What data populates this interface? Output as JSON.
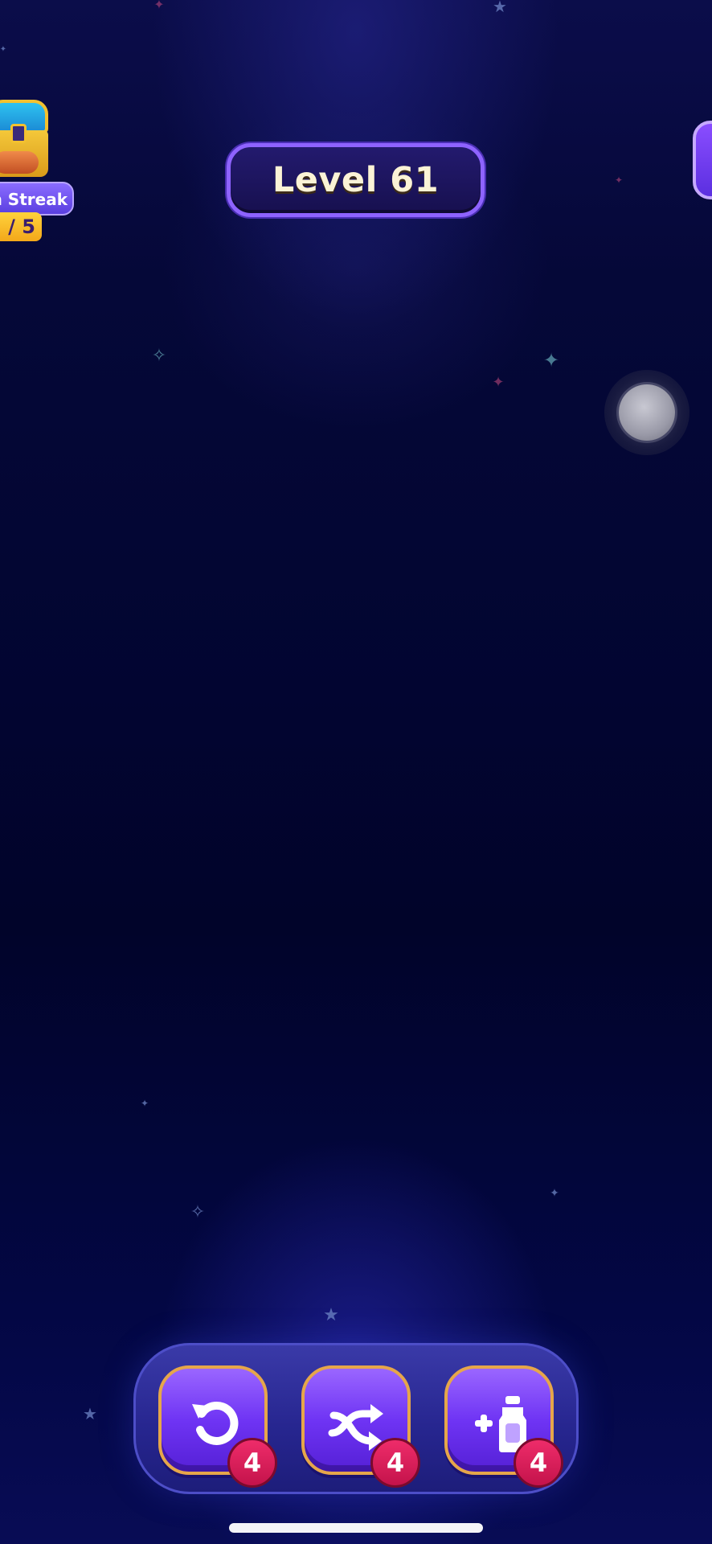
{
  "game": {
    "level_title": "Level 61"
  },
  "win_streak": {
    "label": "n Streak",
    "progress": "/ 5"
  },
  "boosters": [
    {
      "name": "undo",
      "icon": "undo-icon",
      "count": "4"
    },
    {
      "name": "shuffle",
      "icon": "shuffle-icon",
      "count": "4"
    },
    {
      "name": "add-bottle",
      "icon": "add-bottle-icon",
      "count": "4"
    }
  ],
  "colors": {
    "background": "#020531",
    "booster_purple": "#6f34f4",
    "badge_red": "#e01e5a",
    "level_border": "#8e63ff",
    "gold_border": "#e6a64a"
  }
}
